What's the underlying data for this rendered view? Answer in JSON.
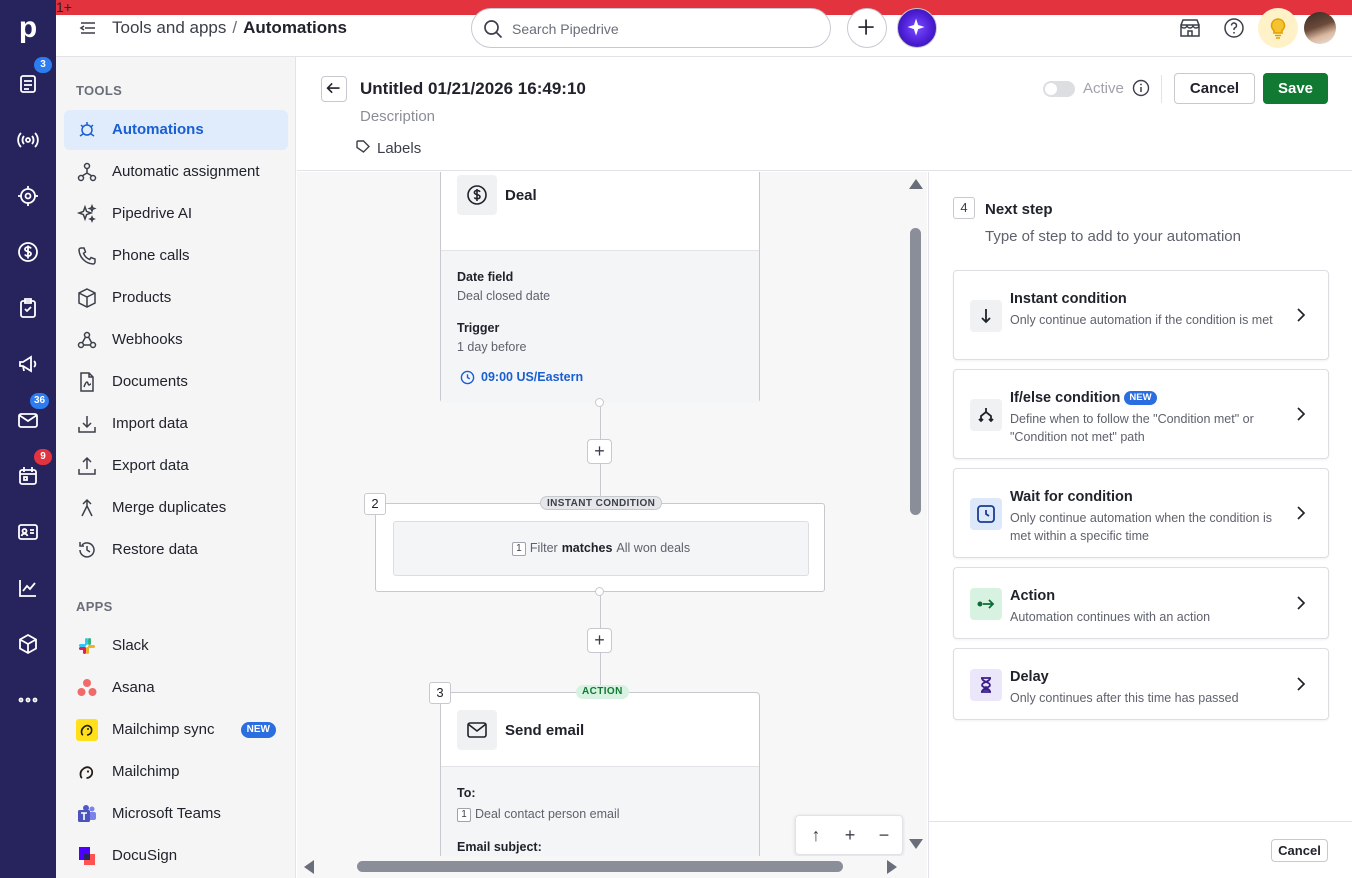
{
  "rail": {
    "badges": {
      "leads": "3",
      "mail": "36",
      "activities": "9"
    }
  },
  "topbar": {
    "breadcrumb_parent": "Tools and apps",
    "breadcrumb_sep": "/",
    "breadcrumb_current": "Automations",
    "search_placeholder": "Search Pipedrive",
    "notification_badge": "1+"
  },
  "sidebar": {
    "tools_title": "TOOLS",
    "tools": [
      {
        "label": "Automations",
        "icon": "automation-robot-icon",
        "active": true
      },
      {
        "label": "Automatic assignment",
        "icon": "assignment-icon"
      },
      {
        "label": "Pipedrive AI",
        "icon": "sparkle-icon"
      },
      {
        "label": "Phone calls",
        "icon": "phone-icon"
      },
      {
        "label": "Products",
        "icon": "box-icon"
      },
      {
        "label": "Webhooks",
        "icon": "webhook-icon"
      },
      {
        "label": "Documents",
        "icon": "document-icon"
      },
      {
        "label": "Import data",
        "icon": "import-icon"
      },
      {
        "label": "Export data",
        "icon": "export-icon"
      },
      {
        "label": "Merge duplicates",
        "icon": "merge-icon"
      },
      {
        "label": "Restore data",
        "icon": "restore-icon"
      }
    ],
    "apps_title": "APPS",
    "apps": [
      {
        "label": "Slack"
      },
      {
        "label": "Asana"
      },
      {
        "label": "Mailchimp sync",
        "badge": "NEW"
      },
      {
        "label": "Mailchimp"
      },
      {
        "label": "Microsoft Teams"
      },
      {
        "label": "DocuSign"
      }
    ]
  },
  "header": {
    "title": "Untitled 01/21/2026 16:49:10",
    "description_placeholder": "Description",
    "labels": "Labels",
    "active_label": "Active",
    "cancel": "Cancel",
    "save": "Save"
  },
  "canvas": {
    "trigger": {
      "entity": "Deal",
      "date_field_label": "Date field",
      "date_field_value": "Deal closed date",
      "trigger_label": "Trigger",
      "trigger_value": "1 day before",
      "time": "09:00 US/Eastern"
    },
    "step2": {
      "number": "2",
      "type": "INSTANT CONDITION",
      "filter_num": "1",
      "filter_word": "Filter",
      "operator": "matches",
      "value": "All won deals"
    },
    "step3": {
      "number": "3",
      "type": "ACTION",
      "title": "Send email",
      "to_label": "To:",
      "to_num": "1",
      "to_value": "Deal contact person email",
      "subject_label": "Email subject:"
    }
  },
  "panel": {
    "step_number": "4",
    "title": "Next step",
    "subtitle": "Type of step to add to your automation",
    "options": [
      {
        "title": "Instant condition",
        "desc": "Only continue automation if the condition is met",
        "icon": "arrow-down-icon"
      },
      {
        "title": "If/else condition",
        "badge": "NEW",
        "desc": "Define when to follow the \"Condition met\" or \"Condition not met\" path",
        "icon": "branch-icon"
      },
      {
        "title": "Wait for condition",
        "desc": "Only continue automation when the condition is met within a specific time",
        "icon": "clock-icon"
      },
      {
        "title": "Action",
        "desc": "Automation continues with an action",
        "icon": "action-arrow-icon"
      },
      {
        "title": "Delay",
        "desc": "Only continues after this time has passed",
        "icon": "hourglass-icon"
      }
    ],
    "footer_cancel": "Cancel"
  },
  "colors": {
    "rail": "#26235d",
    "primary_blue": "#1a5fd1",
    "save_green": "#107a33"
  }
}
